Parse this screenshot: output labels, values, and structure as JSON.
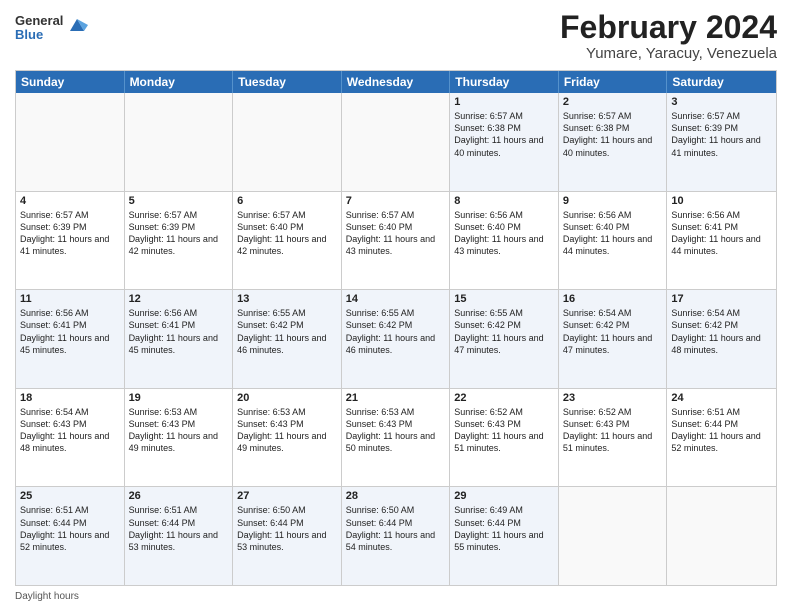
{
  "header": {
    "logo": {
      "line1": "General",
      "line2": "Blue"
    },
    "title": "February 2024",
    "location": "Yumare, Yaracuy, Venezuela"
  },
  "days_of_week": [
    "Sunday",
    "Monday",
    "Tuesday",
    "Wednesday",
    "Thursday",
    "Friday",
    "Saturday"
  ],
  "weeks": [
    [
      {
        "day": "",
        "sunrise": "",
        "sunset": "",
        "daylight": "",
        "empty": true
      },
      {
        "day": "",
        "sunrise": "",
        "sunset": "",
        "daylight": "",
        "empty": true
      },
      {
        "day": "",
        "sunrise": "",
        "sunset": "",
        "daylight": "",
        "empty": true
      },
      {
        "day": "",
        "sunrise": "",
        "sunset": "",
        "daylight": "",
        "empty": true
      },
      {
        "day": "1",
        "sunrise": "Sunrise: 6:57 AM",
        "sunset": "Sunset: 6:38 PM",
        "daylight": "Daylight: 11 hours and 40 minutes.",
        "empty": false
      },
      {
        "day": "2",
        "sunrise": "Sunrise: 6:57 AM",
        "sunset": "Sunset: 6:38 PM",
        "daylight": "Daylight: 11 hours and 40 minutes.",
        "empty": false
      },
      {
        "day": "3",
        "sunrise": "Sunrise: 6:57 AM",
        "sunset": "Sunset: 6:39 PM",
        "daylight": "Daylight: 11 hours and 41 minutes.",
        "empty": false
      }
    ],
    [
      {
        "day": "4",
        "sunrise": "Sunrise: 6:57 AM",
        "sunset": "Sunset: 6:39 PM",
        "daylight": "Daylight: 11 hours and 41 minutes.",
        "empty": false
      },
      {
        "day": "5",
        "sunrise": "Sunrise: 6:57 AM",
        "sunset": "Sunset: 6:39 PM",
        "daylight": "Daylight: 11 hours and 42 minutes.",
        "empty": false
      },
      {
        "day": "6",
        "sunrise": "Sunrise: 6:57 AM",
        "sunset": "Sunset: 6:40 PM",
        "daylight": "Daylight: 11 hours and 42 minutes.",
        "empty": false
      },
      {
        "day": "7",
        "sunrise": "Sunrise: 6:57 AM",
        "sunset": "Sunset: 6:40 PM",
        "daylight": "Daylight: 11 hours and 43 minutes.",
        "empty": false
      },
      {
        "day": "8",
        "sunrise": "Sunrise: 6:56 AM",
        "sunset": "Sunset: 6:40 PM",
        "daylight": "Daylight: 11 hours and 43 minutes.",
        "empty": false
      },
      {
        "day": "9",
        "sunrise": "Sunrise: 6:56 AM",
        "sunset": "Sunset: 6:40 PM",
        "daylight": "Daylight: 11 hours and 44 minutes.",
        "empty": false
      },
      {
        "day": "10",
        "sunrise": "Sunrise: 6:56 AM",
        "sunset": "Sunset: 6:41 PM",
        "daylight": "Daylight: 11 hours and 44 minutes.",
        "empty": false
      }
    ],
    [
      {
        "day": "11",
        "sunrise": "Sunrise: 6:56 AM",
        "sunset": "Sunset: 6:41 PM",
        "daylight": "Daylight: 11 hours and 45 minutes.",
        "empty": false
      },
      {
        "day": "12",
        "sunrise": "Sunrise: 6:56 AM",
        "sunset": "Sunset: 6:41 PM",
        "daylight": "Daylight: 11 hours and 45 minutes.",
        "empty": false
      },
      {
        "day": "13",
        "sunrise": "Sunrise: 6:55 AM",
        "sunset": "Sunset: 6:42 PM",
        "daylight": "Daylight: 11 hours and 46 minutes.",
        "empty": false
      },
      {
        "day": "14",
        "sunrise": "Sunrise: 6:55 AM",
        "sunset": "Sunset: 6:42 PM",
        "daylight": "Daylight: 11 hours and 46 minutes.",
        "empty": false
      },
      {
        "day": "15",
        "sunrise": "Sunrise: 6:55 AM",
        "sunset": "Sunset: 6:42 PM",
        "daylight": "Daylight: 11 hours and 47 minutes.",
        "empty": false
      },
      {
        "day": "16",
        "sunrise": "Sunrise: 6:54 AM",
        "sunset": "Sunset: 6:42 PM",
        "daylight": "Daylight: 11 hours and 47 minutes.",
        "empty": false
      },
      {
        "day": "17",
        "sunrise": "Sunrise: 6:54 AM",
        "sunset": "Sunset: 6:42 PM",
        "daylight": "Daylight: 11 hours and 48 minutes.",
        "empty": false
      }
    ],
    [
      {
        "day": "18",
        "sunrise": "Sunrise: 6:54 AM",
        "sunset": "Sunset: 6:43 PM",
        "daylight": "Daylight: 11 hours and 48 minutes.",
        "empty": false
      },
      {
        "day": "19",
        "sunrise": "Sunrise: 6:53 AM",
        "sunset": "Sunset: 6:43 PM",
        "daylight": "Daylight: 11 hours and 49 minutes.",
        "empty": false
      },
      {
        "day": "20",
        "sunrise": "Sunrise: 6:53 AM",
        "sunset": "Sunset: 6:43 PM",
        "daylight": "Daylight: 11 hours and 49 minutes.",
        "empty": false
      },
      {
        "day": "21",
        "sunrise": "Sunrise: 6:53 AM",
        "sunset": "Sunset: 6:43 PM",
        "daylight": "Daylight: 11 hours and 50 minutes.",
        "empty": false
      },
      {
        "day": "22",
        "sunrise": "Sunrise: 6:52 AM",
        "sunset": "Sunset: 6:43 PM",
        "daylight": "Daylight: 11 hours and 51 minutes.",
        "empty": false
      },
      {
        "day": "23",
        "sunrise": "Sunrise: 6:52 AM",
        "sunset": "Sunset: 6:43 PM",
        "daylight": "Daylight: 11 hours and 51 minutes.",
        "empty": false
      },
      {
        "day": "24",
        "sunrise": "Sunrise: 6:51 AM",
        "sunset": "Sunset: 6:44 PM",
        "daylight": "Daylight: 11 hours and 52 minutes.",
        "empty": false
      }
    ],
    [
      {
        "day": "25",
        "sunrise": "Sunrise: 6:51 AM",
        "sunset": "Sunset: 6:44 PM",
        "daylight": "Daylight: 11 hours and 52 minutes.",
        "empty": false
      },
      {
        "day": "26",
        "sunrise": "Sunrise: 6:51 AM",
        "sunset": "Sunset: 6:44 PM",
        "daylight": "Daylight: 11 hours and 53 minutes.",
        "empty": false
      },
      {
        "day": "27",
        "sunrise": "Sunrise: 6:50 AM",
        "sunset": "Sunset: 6:44 PM",
        "daylight": "Daylight: 11 hours and 53 minutes.",
        "empty": false
      },
      {
        "day": "28",
        "sunrise": "Sunrise: 6:50 AM",
        "sunset": "Sunset: 6:44 PM",
        "daylight": "Daylight: 11 hours and 54 minutes.",
        "empty": false
      },
      {
        "day": "29",
        "sunrise": "Sunrise: 6:49 AM",
        "sunset": "Sunset: 6:44 PM",
        "daylight": "Daylight: 11 hours and 55 minutes.",
        "empty": false
      },
      {
        "day": "",
        "sunrise": "",
        "sunset": "",
        "daylight": "",
        "empty": true
      },
      {
        "day": "",
        "sunrise": "",
        "sunset": "",
        "daylight": "",
        "empty": true
      }
    ]
  ],
  "footer": {
    "daylight_label": "Daylight hours"
  },
  "colors": {
    "header_bg": "#2a6db5",
    "even_row": "#eef2fa",
    "odd_row": "#ffffff",
    "empty_cell": "#f5f5f5"
  }
}
